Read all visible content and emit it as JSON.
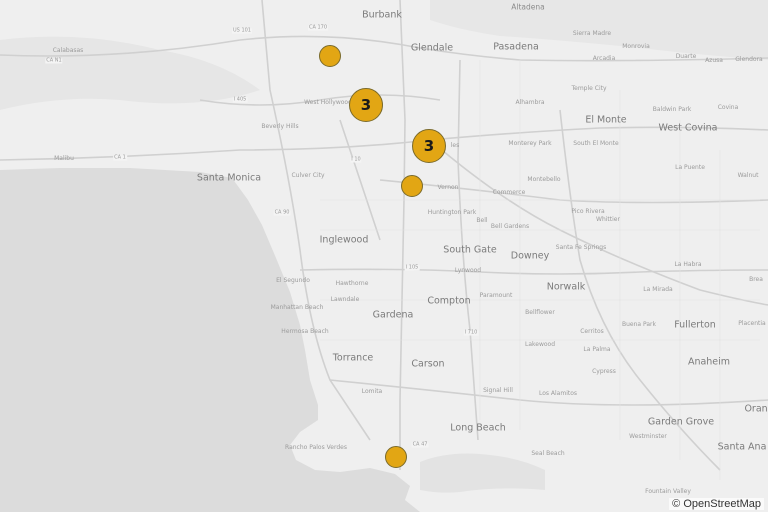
{
  "attribution": "© OpenStreetMap",
  "colors": {
    "marker_fill": "#e2a614",
    "marker_stroke": "#7a6a2a",
    "land": "#efefef",
    "water": "#dcdcdc"
  },
  "markers": [
    {
      "id": "marker-van-nuys",
      "count": ""
    },
    {
      "id": "marker-west-hollywood",
      "count": "3"
    },
    {
      "id": "marker-downtown-la",
      "count": "3"
    },
    {
      "id": "marker-vernon",
      "count": ""
    },
    {
      "id": "marker-san-pedro",
      "count": ""
    }
  ],
  "places": {
    "burbank": "Burbank",
    "glendale": "Glendale",
    "pasadena": "Pasadena",
    "altadena": "Altadena",
    "sierra_madre": "Sierra Madre",
    "monrovia": "Monrovia",
    "duarte": "Duarte",
    "azusa": "Azusa",
    "glendora": "Glendora",
    "arcadia": "Arcadia",
    "temple_city": "Temple City",
    "alhambra": "Alhambra",
    "baldwin_park": "Baldwin Park",
    "covina": "Covina",
    "el_monte": "El Monte",
    "west_covina": "West Covina",
    "monterey_park": "Monterey Park",
    "south_el_monte": "South El Monte",
    "la_puente": "La Puente",
    "walnut": "Walnut",
    "montebello": "Montebello",
    "pico_rivera": "Pico Rivera",
    "whittier": "Whittier",
    "la_habra": "La Habra",
    "brea": "Brea",
    "la_mirada": "La Mirada",
    "fullerton": "Fullerton",
    "placentia": "Placentia",
    "anaheim": "Anaheim",
    "orange": "Orange",
    "garden_grove": "Garden Grove",
    "santa_ana": "Santa Ana",
    "westminster": "Westminster",
    "fountain_valley": "Fountain Valley",
    "buena_park": "Buena Park",
    "cerritos": "Cerritos",
    "la_palma": "La Palma",
    "cypress": "Cypress",
    "los_alamitos": "Los Alamitos",
    "seal_beach": "Seal Beach",
    "long_beach": "Long Beach",
    "signal_hill": "Signal Hill",
    "lakewood": "Lakewood",
    "bellflower": "Bellflower",
    "norwalk": "Norwalk",
    "downey": "Downey",
    "santa_fe_springs": "Santa Fe Springs",
    "paramount": "Paramount",
    "lynwood": "Lynwood",
    "south_gate": "South Gate",
    "bell_gardens": "Bell Gardens",
    "bell": "Bell",
    "commerce": "Commerce",
    "vernon": "Vernon",
    "huntington_park": "Huntington Park",
    "compton": "Compton",
    "carson": "Carson",
    "gardena": "Gardena",
    "torrance": "Torrance",
    "lomita": "Lomita",
    "rancho_palos_verdes": "Rancho Palos Verdes",
    "hawthorne": "Hawthorne",
    "lawndale": "Lawndale",
    "manhattan_beach": "Manhattan Beach",
    "hermosa_beach": "Hermosa Beach",
    "el_segundo": "El Segundo",
    "inglewood": "Inglewood",
    "culver_city": "Culver City",
    "santa_monica": "Santa Monica",
    "beverly_hills": "Beverly Hills",
    "west_hollywood": "West Hollywood",
    "calabasas": "Calabasas",
    "malibu": "Malibu",
    "los_angeles_fragment": "les"
  },
  "roads": {
    "ca170": "CA 170",
    "us101": "US 101",
    "i405": "I 405",
    "i10": "I 10",
    "ca1": "CA 1",
    "ca90": "CA 90",
    "i105": "I 105",
    "i710": "I 710",
    "ca47": "CA 47",
    "ca_n1": "CA N1"
  }
}
